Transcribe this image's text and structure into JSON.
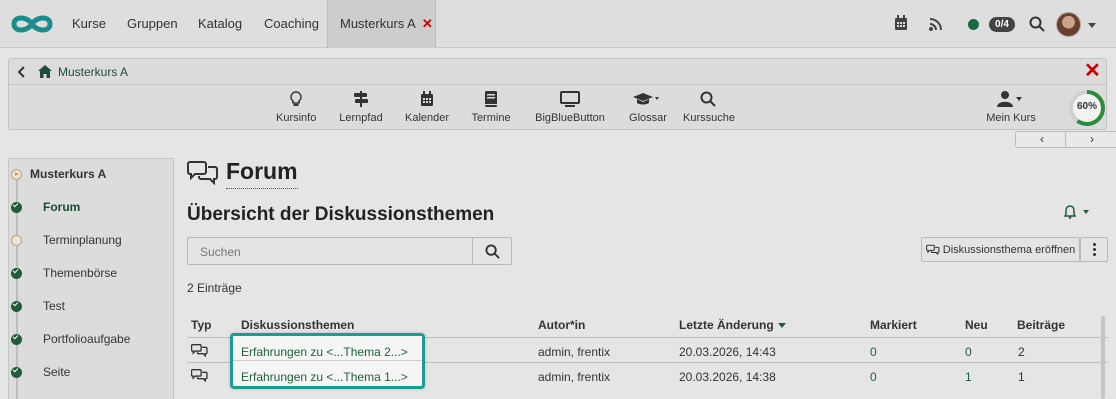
{
  "topnav": {
    "tabs": [
      {
        "label": "Kurse"
      },
      {
        "label": "Gruppen"
      },
      {
        "label": "Katalog"
      },
      {
        "label": "Coaching"
      }
    ],
    "active_tab": {
      "label": "Musterkurs A",
      "close": "✕"
    },
    "badge": "0/4",
    "icons": [
      "logo-icon",
      "calendar-icon",
      "rss-icon",
      "status-dot-icon",
      "search-icon",
      "avatar",
      "chevron-down-icon"
    ]
  },
  "course": {
    "breadcrumb": "Musterkurs A",
    "close": "✕",
    "tools": [
      {
        "label": "Kursinfo",
        "icon": "lightbulb-icon"
      },
      {
        "label": "Lernpfad",
        "icon": "signpost-icon"
      },
      {
        "label": "Kalender",
        "icon": "calendar-icon"
      },
      {
        "label": "Termine",
        "icon": "book-icon"
      },
      {
        "label": "BigBlueButton",
        "icon": "monitor-icon"
      },
      {
        "label": "Glossar",
        "icon": "graduation-cap-icon"
      },
      {
        "label": "Kurssuche",
        "icon": "search-icon"
      }
    ],
    "my_course": "Mein Kurs",
    "progress_label": "60%",
    "progress": 0.6,
    "prev": "‹",
    "next": "›"
  },
  "menu": {
    "root": "Musterkurs A",
    "items": [
      {
        "label": "Forum",
        "status": "done"
      },
      {
        "label": "Terminplanung",
        "status": "open"
      },
      {
        "label": "Themenbörse",
        "status": "done"
      },
      {
        "label": "Test",
        "status": "done"
      },
      {
        "label": "Portfolioaufgabe",
        "status": "done"
      },
      {
        "label": "Seite",
        "status": "done"
      }
    ]
  },
  "main": {
    "title": "Forum",
    "subtitle": "Übersicht der Diskussionsthemen",
    "search_placeholder": "Suchen",
    "new_thread_button": "Diskussionsthema eröffnen",
    "entries_count": "2 Einträge",
    "columns": [
      "Typ",
      "Diskussionsthemen",
      "Autor*in",
      "Letzte Änderung",
      "Markiert",
      "Neu",
      "Beiträge"
    ],
    "rows": [
      {
        "topic": "Erfahrungen zu <...Thema 2...>",
        "author": "admin, frentix",
        "changed": "20.03.2026, 14:43",
        "marked": "0",
        "new": "0",
        "posts": "2"
      },
      {
        "topic": "Erfahrungen zu <...Thema 1...>",
        "author": "admin, frentix",
        "changed": "20.03.2026, 14:38",
        "marked": "0",
        "new": "1",
        "posts": "1"
      }
    ]
  },
  "colors": {
    "accent": "#1d5f3a",
    "highlight": "#1b9e8f",
    "close": "#cc0000",
    "logo": "#1b8c8c"
  }
}
